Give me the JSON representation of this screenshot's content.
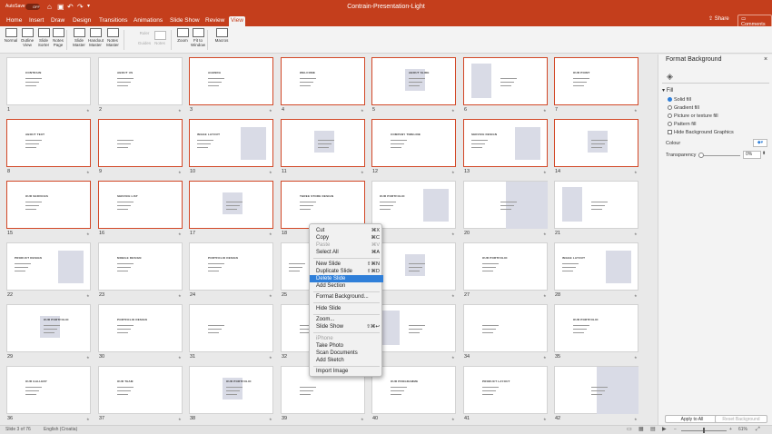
{
  "titlebar": {
    "autosave_label": "AutoSave",
    "autosave_state": "OFF",
    "document_title": "Contrain-Presentation-Light"
  },
  "ribbon_tabs": [
    {
      "label": "Home",
      "active": false
    },
    {
      "label": "Insert",
      "active": false
    },
    {
      "label": "Draw",
      "active": false
    },
    {
      "label": "Design",
      "active": false
    },
    {
      "label": "Transitions",
      "active": false
    },
    {
      "label": "Animations",
      "active": false
    },
    {
      "label": "Slide Show",
      "active": false
    },
    {
      "label": "Review",
      "active": false
    },
    {
      "label": "View",
      "active": true
    }
  ],
  "share_label": "Share",
  "comments_label": "Comments",
  "ribbon_buttons": [
    {
      "label": "Normal",
      "enabled": true
    },
    {
      "label": "Outline View",
      "enabled": true
    },
    {
      "label": "Slide Sorter",
      "enabled": true
    },
    {
      "label": "Notes Page",
      "enabled": true
    },
    {
      "label": "Slide Master",
      "enabled": true
    },
    {
      "label": "Handout Master",
      "enabled": true
    },
    {
      "label": "Notes Master",
      "enabled": true
    },
    {
      "label": "Ruler",
      "enabled": false
    },
    {
      "label": "Guides",
      "enabled": false
    },
    {
      "label": "Notes",
      "enabled": false
    },
    {
      "label": "Zoom",
      "enabled": true
    },
    {
      "label": "Fit to Window",
      "enabled": true
    },
    {
      "label": "Macros",
      "enabled": true
    }
  ],
  "slides": [
    {
      "n": "1",
      "sel": false,
      "text": "CONTRAIN"
    },
    {
      "n": "2",
      "sel": false,
      "text": "ABOUT US"
    },
    {
      "n": "3",
      "sel": true,
      "text": "AGENDA"
    },
    {
      "n": "4",
      "sel": true,
      "text": "WELCOME"
    },
    {
      "n": "5",
      "sel": true,
      "text": "ABOUT SLIDE"
    },
    {
      "n": "6",
      "sel": true,
      "text": ""
    },
    {
      "n": "7",
      "sel": true,
      "text": "OUR POINT"
    },
    {
      "n": "8",
      "sel": true,
      "text": "ABOUT TEXT"
    },
    {
      "n": "9",
      "sel": true,
      "text": ""
    },
    {
      "n": "10",
      "sel": true,
      "text": "IMAGE LAYOUT"
    },
    {
      "n": "11",
      "sel": true,
      "text": ""
    },
    {
      "n": "12",
      "sel": true,
      "text": "COMPANY TIMELINE"
    },
    {
      "n": "13",
      "sel": true,
      "text": "SERVICE DESIGN"
    },
    {
      "n": "14",
      "sel": true,
      "text": ""
    },
    {
      "n": "15",
      "sel": true,
      "text": "OUR SERVICES"
    },
    {
      "n": "16",
      "sel": true,
      "text": "SERVICE LIST"
    },
    {
      "n": "17",
      "sel": true,
      "text": ""
    },
    {
      "n": "18",
      "sel": true,
      "text": "THREE STORE DESIGN"
    },
    {
      "n": "19",
      "sel": false,
      "text": "OUR PORTFOLIO"
    },
    {
      "n": "20",
      "sel": false,
      "text": ""
    },
    {
      "n": "21",
      "sel": false,
      "text": ""
    },
    {
      "n": "22",
      "sel": false,
      "text": "PRODUCT DESIGN"
    },
    {
      "n": "23",
      "sel": false,
      "text": "MOBILE DESIGN"
    },
    {
      "n": "24",
      "sel": false,
      "text": "PORTFOLIO DESIGN"
    },
    {
      "n": "25",
      "sel": false,
      "text": ""
    },
    {
      "n": "26",
      "sel": false,
      "text": ""
    },
    {
      "n": "27",
      "sel": false,
      "text": "OUR PORTFOLIO"
    },
    {
      "n": "28",
      "sel": false,
      "text": "IMAGE LAYOUT"
    },
    {
      "n": "29",
      "sel": false,
      "text": "OUR PORTFOLIO"
    },
    {
      "n": "30",
      "sel": false,
      "text": "PORTFOLIO DESIGN"
    },
    {
      "n": "31",
      "sel": false,
      "text": ""
    },
    {
      "n": "32",
      "sel": false,
      "text": ""
    },
    {
      "n": "33",
      "sel": false,
      "text": ""
    },
    {
      "n": "34",
      "sel": false,
      "text": ""
    },
    {
      "n": "35",
      "sel": false,
      "text": "OUR PORTFOLIO"
    },
    {
      "n": "36",
      "sel": false,
      "text": "OUR GALLERY"
    },
    {
      "n": "37",
      "sel": false,
      "text": "OUR TEAM"
    },
    {
      "n": "38",
      "sel": false,
      "text": "OUR PORTFOLIO"
    },
    {
      "n": "39",
      "sel": false,
      "text": ""
    },
    {
      "n": "40",
      "sel": false,
      "text": "OUR PROGRAMME"
    },
    {
      "n": "41",
      "sel": false,
      "text": "PRODUCT LAYOUT"
    },
    {
      "n": "42",
      "sel": false,
      "text": ""
    }
  ],
  "context_menu": [
    {
      "label": "Cut",
      "shortcut": "⌘X",
      "disabled": false
    },
    {
      "label": "Copy",
      "shortcut": "⌘C",
      "disabled": false
    },
    {
      "label": "Paste",
      "shortcut": "⌘V",
      "disabled": true
    },
    {
      "label": "Select All",
      "shortcut": "⌘A",
      "disabled": false
    },
    {
      "sep": true
    },
    {
      "label": "New Slide",
      "shortcut": "⇧⌘N",
      "disabled": false
    },
    {
      "label": "Duplicate Slide",
      "shortcut": "⇧⌘D",
      "disabled": false
    },
    {
      "label": "Delete Slide",
      "shortcut": "",
      "disabled": false,
      "highlight": true
    },
    {
      "label": "Add Section",
      "shortcut": "",
      "disabled": false
    },
    {
      "sep": true
    },
    {
      "label": "Format Background...",
      "shortcut": "",
      "disabled": false
    },
    {
      "sep": true
    },
    {
      "label": "Hide Slide",
      "shortcut": "",
      "disabled": false
    },
    {
      "sep": true
    },
    {
      "label": "Zoom...",
      "shortcut": "",
      "disabled": false
    },
    {
      "label": "Slide Show",
      "shortcut": "⇧⌘↩",
      "disabled": false
    },
    {
      "sep": true
    },
    {
      "label": "iPhone",
      "shortcut": "",
      "disabled": true
    },
    {
      "label": "Take Photo",
      "shortcut": "",
      "disabled": false
    },
    {
      "label": "Scan Documents",
      "shortcut": "",
      "disabled": false
    },
    {
      "label": "Add Sketch",
      "shortcut": "",
      "disabled": false
    },
    {
      "sep": true
    },
    {
      "label": "Import Image",
      "shortcut": "",
      "disabled": false
    }
  ],
  "panel": {
    "title": "Format Background",
    "fill_header": "Fill",
    "fill_options": [
      {
        "label": "Solid fill",
        "selected": true
      },
      {
        "label": "Gradient fill",
        "selected": false
      },
      {
        "label": "Picture or texture fill",
        "selected": false
      },
      {
        "label": "Pattern fill",
        "selected": false
      }
    ],
    "hide_graphics_label": "Hide Background Graphics",
    "colour_label": "Colour",
    "transparency_label": "Transparency",
    "transparency_value": "0%",
    "apply_all_label": "Apply to All",
    "reset_label": "Reset Background"
  },
  "status": {
    "slide_info": "Slide 3 of 76",
    "language": "English (Croatia)",
    "zoom": "61%"
  },
  "colors": {
    "accent": "#c43e1c",
    "selection": "#d24726",
    "menu_highlight": "#2f7fd9"
  }
}
